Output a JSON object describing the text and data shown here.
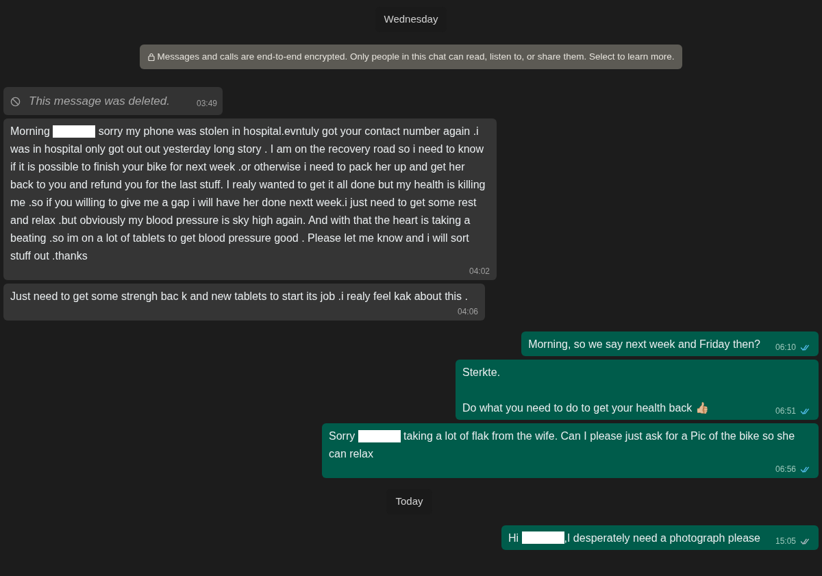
{
  "chat": [
    {
      "kind": "date",
      "text": "Wednesday"
    },
    {
      "kind": "notice",
      "text": "Messages and calls are end-to-end encrypted. Only people in this chat can read, listen to, or share them. Select to learn more."
    },
    {
      "kind": "deleted",
      "text": "This message was deleted.",
      "time": "03:49"
    },
    {
      "kind": "in",
      "parts": [
        {
          "kind": "text",
          "text": "Morning "
        },
        {
          "kind": "redaction"
        },
        {
          "kind": "text",
          "text": " sorry my phone was stolen in hospital.evntuly got your contact number again .i was in hospital only got out out yesterday  long story . I am on the recovery road so i need to know if it is possible to finish your bike for next week .or otherwise i need to pack her up and get her back to you and refund you for the last stuff. I realy wanted to get it all done but my health is killing me .so if you willing  to give me a gap i will have her done nextt week.i just need to get some rest and relax .but obviously my blood pressure is sky high again. And with that the heart is taking a beating .so im on a lot of tablets to get blood pressure good . Please let me know and i will sort stuff out .thanks"
        }
      ],
      "time": "04:02"
    },
    {
      "kind": "in",
      "parts": [
        {
          "kind": "text",
          "text": "Just need to get some strengh bac k and new tablets to start its job .i realy feel kak about this ."
        }
      ],
      "time": "04:06"
    },
    {
      "kind": "out",
      "parts": [
        {
          "kind": "text",
          "text": "Morning, so we say next week and Friday then?"
        }
      ],
      "time": "06:10",
      "read": true
    },
    {
      "kind": "out",
      "parts": [
        {
          "kind": "text",
          "text": "Sterkte.\n\nDo what you need to do to get your health back 👍🏼"
        }
      ],
      "time": "06:51",
      "read": true
    },
    {
      "kind": "out",
      "parts": [
        {
          "kind": "text",
          "text": "Sorry "
        },
        {
          "kind": "redaction"
        },
        {
          "kind": "text",
          "text": " taking a lot of flak from the wife. Can I please just ask for a Pic of the bike so she can relax"
        }
      ],
      "time": "06:56",
      "read": true
    },
    {
      "kind": "date",
      "text": "Today"
    },
    {
      "kind": "out",
      "parts": [
        {
          "kind": "text",
          "text": "Hi "
        },
        {
          "kind": "redaction"
        },
        {
          "kind": "text",
          "text": ",I desperately need a photograph please"
        }
      ],
      "time": "15:05",
      "read": false
    }
  ]
}
